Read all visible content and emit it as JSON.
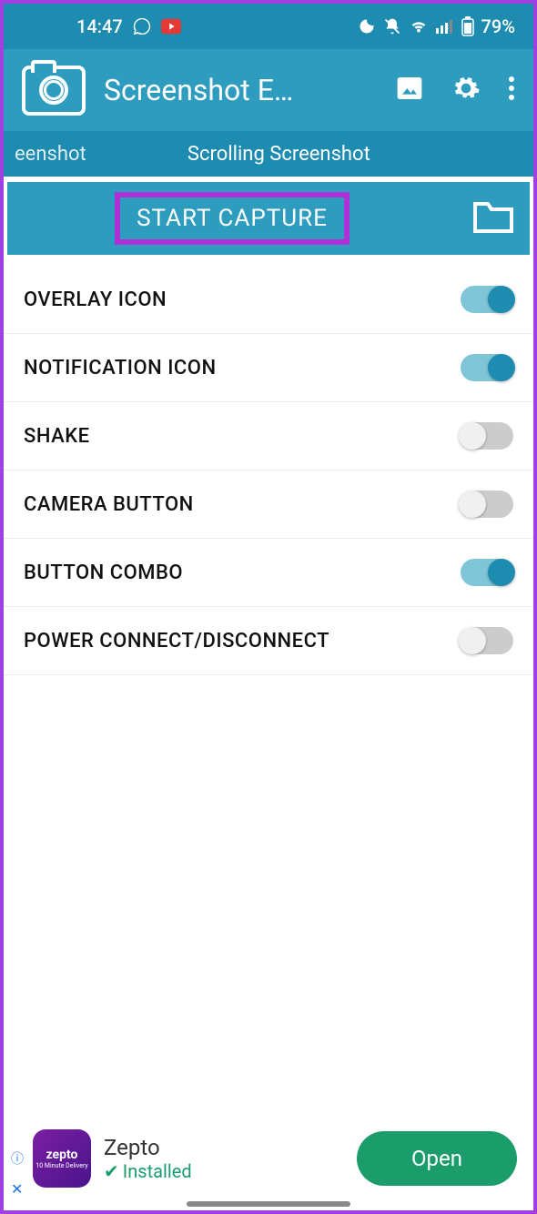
{
  "status": {
    "time": "14:47",
    "battery": "79%"
  },
  "header": {
    "title": "Screenshot E…"
  },
  "tabs": {
    "partial": "eenshot",
    "active": "Scrolling Screenshot"
  },
  "capture": {
    "button": "START CAPTURE"
  },
  "settings": [
    {
      "label": "OVERLAY ICON",
      "on": true
    },
    {
      "label": "NOTIFICATION ICON",
      "on": true
    },
    {
      "label": "SHAKE",
      "on": false
    },
    {
      "label": "CAMERA BUTTON",
      "on": false
    },
    {
      "label": "BUTTON COMBO",
      "on": true
    },
    {
      "label": "POWER CONNECT/DISCONNECT",
      "on": false
    }
  ],
  "ad": {
    "brand": "zepto",
    "brand_sub": "10 Minute Delivery",
    "title": "Zepto",
    "status": "Installed",
    "cta": "Open"
  }
}
